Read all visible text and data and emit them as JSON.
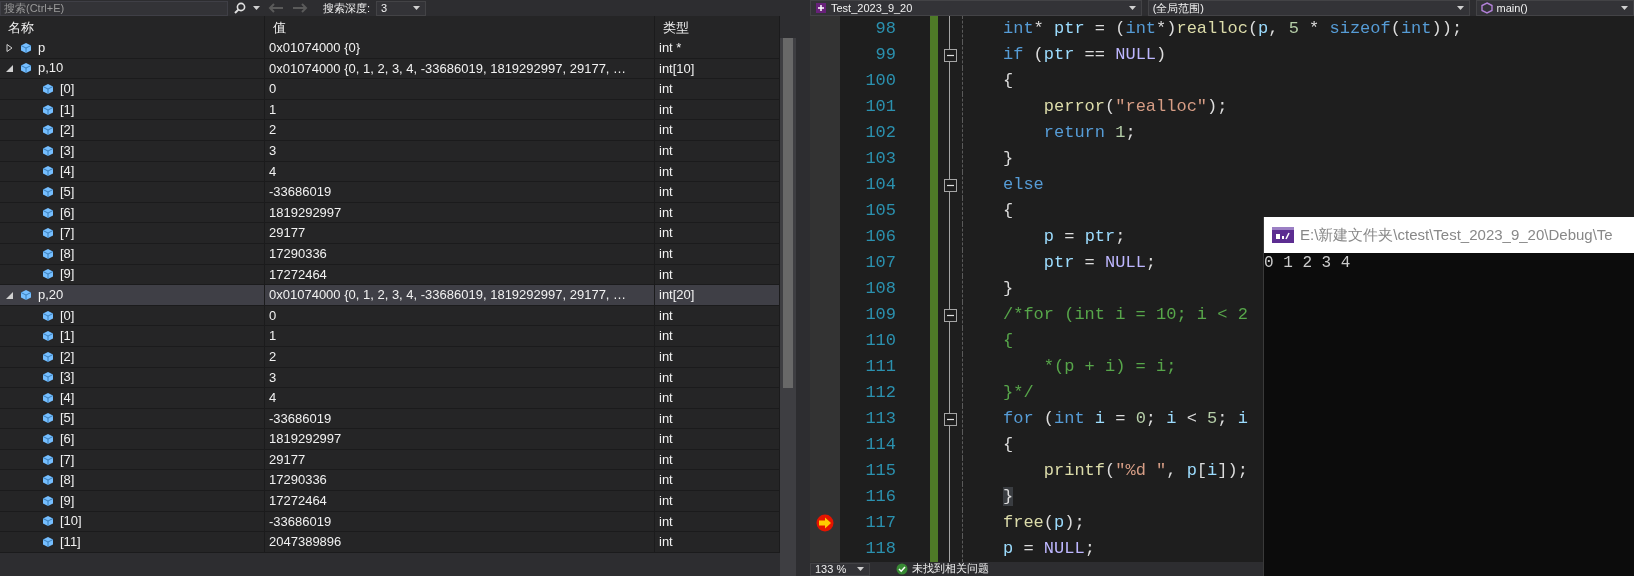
{
  "watch_toolbar": {
    "search": {
      "placeholder": "搜索(Ctrl+E)"
    },
    "nav": [
      {
        "kind": "back",
        "disabled": true
      },
      {
        "kind": "forward",
        "disabled": true
      }
    ],
    "depth_label": "搜索深度:",
    "depth": "3"
  },
  "watch": {
    "columns": [
      "名称",
      "值",
      "类型"
    ],
    "rows": [
      {
        "name": "p",
        "value": "0x01074000 {0}",
        "type": "int *",
        "expanded": false,
        "selected": false
      },
      {
        "name": "p,10",
        "value": "0x01074000 {0, 1, 2, 3, 4, -33686019, 1819292997, 29177, …",
        "type": "int[10]",
        "expanded": true,
        "selected": false,
        "children": [
          {
            "name": "[0]",
            "value": "0",
            "type": "int",
            "selected": false
          },
          {
            "name": "[1]",
            "value": "1",
            "type": "int",
            "selected": false
          },
          {
            "name": "[2]",
            "value": "2",
            "type": "int",
            "selected": false
          },
          {
            "name": "[3]",
            "value": "3",
            "type": "int",
            "selected": false
          },
          {
            "name": "[4]",
            "value": "4",
            "type": "int",
            "selected": false
          },
          {
            "name": "[5]",
            "value": "-33686019",
            "type": "int",
            "selected": false
          },
          {
            "name": "[6]",
            "value": "1819292997",
            "type": "int",
            "selected": false
          },
          {
            "name": "[7]",
            "value": "29177",
            "type": "int",
            "selected": false
          },
          {
            "name": "[8]",
            "value": "17290336",
            "type": "int",
            "selected": false
          },
          {
            "name": "[9]",
            "value": "17272464",
            "type": "int",
            "selected": false
          }
        ]
      },
      {
        "name": "p,20",
        "value": "0x01074000 {0, 1, 2, 3, 4, -33686019, 1819292997, 29177, …",
        "type": "int[20]",
        "expanded": true,
        "selected": true,
        "children": [
          {
            "name": "[0]",
            "value": "0",
            "type": "int",
            "selected": false
          },
          {
            "name": "[1]",
            "value": "1",
            "type": "int",
            "selected": false
          },
          {
            "name": "[2]",
            "value": "2",
            "type": "int",
            "selected": false
          },
          {
            "name": "[3]",
            "value": "3",
            "type": "int",
            "selected": false
          },
          {
            "name": "[4]",
            "value": "4",
            "type": "int",
            "selected": false
          },
          {
            "name": "[5]",
            "value": "-33686019",
            "type": "int",
            "selected": false
          },
          {
            "name": "[6]",
            "value": "1819292997",
            "type": "int",
            "selected": false
          },
          {
            "name": "[7]",
            "value": "29177",
            "type": "int",
            "selected": false
          },
          {
            "name": "[8]",
            "value": "17290336",
            "type": "int",
            "selected": false
          },
          {
            "name": "[9]",
            "value": "17272464",
            "type": "int",
            "selected": false
          },
          {
            "name": "[10]",
            "value": "-33686019",
            "type": "int",
            "selected": false
          },
          {
            "name": "[11]",
            "value": "2047389896",
            "type": "int",
            "selected": false
          }
        ]
      }
    ]
  },
  "editor": {
    "file": "Test_2023_9_20",
    "scope": "(全局范围)",
    "function": "main()",
    "lines": [
      {
        "number": "98",
        "fold": false,
        "current_statement": false,
        "tokens": [
          {
            "kind": "keyword",
            "text": "int"
          },
          {
            "kind": "plain",
            "text": "* "
          },
          {
            "kind": "variable",
            "text": "ptr"
          },
          {
            "kind": "plain",
            "text": " = ("
          },
          {
            "kind": "keyword",
            "text": "int"
          },
          {
            "kind": "plain",
            "text": "*)"
          },
          {
            "kind": "function",
            "text": "realloc"
          },
          {
            "kind": "plain",
            "text": "("
          },
          {
            "kind": "variable",
            "text": "p"
          },
          {
            "kind": "plain",
            "text": ", "
          },
          {
            "kind": "number",
            "text": "5"
          },
          {
            "kind": "plain",
            "text": " * "
          },
          {
            "kind": "keyword",
            "text": "sizeof"
          },
          {
            "kind": "plain",
            "text": "("
          },
          {
            "kind": "keyword",
            "text": "int"
          },
          {
            "kind": "plain",
            "text": "));"
          }
        ]
      },
      {
        "number": "99",
        "fold": true,
        "current_statement": false,
        "tokens": [
          {
            "kind": "keyword",
            "text": "if"
          },
          {
            "kind": "plain",
            "text": " ("
          },
          {
            "kind": "variable",
            "text": "ptr"
          },
          {
            "kind": "plain",
            "text": " == "
          },
          {
            "kind": "macro",
            "text": "NULL"
          },
          {
            "kind": "plain",
            "text": ")"
          }
        ]
      },
      {
        "number": "100",
        "fold": false,
        "current_statement": false,
        "tokens": [
          {
            "kind": "plain",
            "text": "{"
          }
        ]
      },
      {
        "number": "101",
        "fold": false,
        "current_statement": false,
        "tokens": [
          {
            "kind": "function",
            "text": "    perror"
          },
          {
            "kind": "plain",
            "text": "("
          },
          {
            "kind": "string",
            "text": "\"realloc\""
          },
          {
            "kind": "plain",
            "text": ");"
          }
        ]
      },
      {
        "number": "102",
        "fold": false,
        "current_statement": false,
        "tokens": [
          {
            "kind": "keyword",
            "text": "    return "
          },
          {
            "kind": "number",
            "text": "1"
          },
          {
            "kind": "plain",
            "text": ";"
          }
        ]
      },
      {
        "number": "103",
        "fold": false,
        "current_statement": false,
        "tokens": [
          {
            "kind": "plain",
            "text": "}"
          }
        ]
      },
      {
        "number": "104",
        "fold": true,
        "current_statement": false,
        "tokens": [
          {
            "kind": "keyword",
            "text": "else"
          }
        ]
      },
      {
        "number": "105",
        "fold": false,
        "current_statement": false,
        "tokens": [
          {
            "kind": "plain",
            "text": "{"
          }
        ]
      },
      {
        "number": "106",
        "fold": false,
        "current_statement": false,
        "tokens": [
          {
            "kind": "variable",
            "text": "    p"
          },
          {
            "kind": "plain",
            "text": " = "
          },
          {
            "kind": "variable",
            "text": "ptr"
          },
          {
            "kind": "plain",
            "text": ";"
          }
        ]
      },
      {
        "number": "107",
        "fold": false,
        "current_statement": false,
        "tokens": [
          {
            "kind": "variable",
            "text": "    ptr"
          },
          {
            "kind": "plain",
            "text": " = "
          },
          {
            "kind": "macro",
            "text": "NULL"
          },
          {
            "kind": "plain",
            "text": ";"
          }
        ]
      },
      {
        "number": "108",
        "fold": false,
        "current_statement": false,
        "tokens": [
          {
            "kind": "plain",
            "text": "}"
          }
        ]
      },
      {
        "number": "109",
        "fold": true,
        "current_statement": false,
        "tokens": [
          {
            "kind": "comment",
            "text": "/*for (int i = 10; i < 2"
          }
        ]
      },
      {
        "number": "110",
        "fold": false,
        "current_statement": false,
        "tokens": [
          {
            "kind": "comment",
            "text": "{"
          }
        ]
      },
      {
        "number": "111",
        "fold": false,
        "current_statement": false,
        "tokens": [
          {
            "kind": "comment",
            "text": "    *(p + i) = i;"
          }
        ]
      },
      {
        "number": "112",
        "fold": false,
        "current_statement": false,
        "tokens": [
          {
            "kind": "comment",
            "text": "}*/"
          }
        ]
      },
      {
        "number": "113",
        "fold": true,
        "current_statement": false,
        "tokens": [
          {
            "kind": "keyword",
            "text": "for"
          },
          {
            "kind": "plain",
            "text": " ("
          },
          {
            "kind": "keyword",
            "text": "int "
          },
          {
            "kind": "variable",
            "text": "i"
          },
          {
            "kind": "plain",
            "text": " = "
          },
          {
            "kind": "number",
            "text": "0"
          },
          {
            "kind": "plain",
            "text": "; "
          },
          {
            "kind": "variable",
            "text": "i"
          },
          {
            "kind": "plain",
            "text": " < "
          },
          {
            "kind": "number",
            "text": "5"
          },
          {
            "kind": "plain",
            "text": "; "
          },
          {
            "kind": "variable",
            "text": "i"
          }
        ]
      },
      {
        "number": "114",
        "fold": false,
        "current_statement": false,
        "tokens": [
          {
            "kind": "plain",
            "text": "{"
          }
        ]
      },
      {
        "number": "115",
        "fold": false,
        "current_statement": false,
        "tokens": [
          {
            "kind": "function",
            "text": "    printf"
          },
          {
            "kind": "plain",
            "text": "("
          },
          {
            "kind": "string",
            "text": "\"%d \""
          },
          {
            "kind": "plain",
            "text": ", "
          },
          {
            "kind": "variable",
            "text": "p"
          },
          {
            "kind": "plain",
            "text": "["
          },
          {
            "kind": "variable",
            "text": "i"
          },
          {
            "kind": "plain",
            "text": "]);"
          }
        ]
      },
      {
        "number": "116",
        "fold": false,
        "current_statement": false,
        "tokens": [
          {
            "kind": "brace-match",
            "text": "}"
          }
        ]
      },
      {
        "number": "117",
        "fold": false,
        "current_statement": true,
        "tokens": [
          {
            "kind": "function",
            "text": "free"
          },
          {
            "kind": "plain",
            "text": "("
          },
          {
            "kind": "variable",
            "text": "p"
          },
          {
            "kind": "plain",
            "text": ");"
          }
        ]
      },
      {
        "number": "118",
        "fold": false,
        "current_statement": false,
        "tokens": [
          {
            "kind": "variable",
            "text": "p"
          },
          {
            "kind": "plain",
            "text": " = "
          },
          {
            "kind": "macro",
            "text": "NULL"
          },
          {
            "kind": "plain",
            "text": ";"
          }
        ]
      }
    ],
    "zoom": "133 %",
    "status": "未找到相关问题"
  },
  "console": {
    "title": "E:\\新建文件夹\\ctest\\Test_2023_9_20\\Debug\\Te",
    "output": "0 1 2 3 4"
  }
}
